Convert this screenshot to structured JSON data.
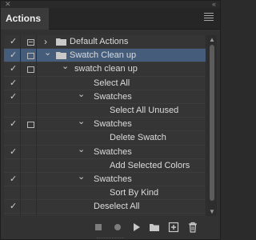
{
  "window": {
    "close_glyph": "✕",
    "collapse_glyph": "‹‹"
  },
  "tab": {
    "label": "Actions"
  },
  "rows": [
    {
      "label": "Default Actions",
      "checked": true,
      "dialog": "toggle-on",
      "expand": "collapsed",
      "indent": 0,
      "folder": true,
      "selected": false
    },
    {
      "label": "Swatch Clean up",
      "checked": true,
      "dialog": "toggle-off",
      "expand": "expanded",
      "indent": 0,
      "folder": true,
      "selected": true
    },
    {
      "label": "swatch clean up",
      "checked": true,
      "dialog": "toggle-off",
      "expand": "expanded",
      "indent": 1,
      "folder": false,
      "selected": false
    },
    {
      "label": "Select All",
      "checked": true,
      "dialog": "",
      "expand": "",
      "indent": 2,
      "folder": false,
      "selected": false
    },
    {
      "label": "Swatches",
      "checked": true,
      "dialog": "",
      "expand": "expanded",
      "indent": 2,
      "folder": false,
      "selected": false
    },
    {
      "label": "Select All Unused",
      "checked": false,
      "dialog": "",
      "expand": "",
      "indent": 3,
      "folder": false,
      "selected": false
    },
    {
      "label": "Swatches",
      "checked": true,
      "dialog": "toggle-off",
      "expand": "expanded",
      "indent": 2,
      "folder": false,
      "selected": false
    },
    {
      "label": "Delete Swatch",
      "checked": false,
      "dialog": "",
      "expand": "",
      "indent": 3,
      "folder": false,
      "selected": false
    },
    {
      "label": "Swatches",
      "checked": true,
      "dialog": "",
      "expand": "expanded",
      "indent": 2,
      "folder": false,
      "selected": false
    },
    {
      "label": "Add Selected Colors",
      "checked": false,
      "dialog": "",
      "expand": "",
      "indent": 3,
      "folder": false,
      "selected": false
    },
    {
      "label": "Swatches",
      "checked": true,
      "dialog": "",
      "expand": "expanded",
      "indent": 2,
      "folder": false,
      "selected": false
    },
    {
      "label": "Sort By Kind",
      "checked": false,
      "dialog": "",
      "expand": "",
      "indent": 3,
      "folder": false,
      "selected": false
    },
    {
      "label": "Deselect All",
      "checked": true,
      "dialog": "",
      "expand": "",
      "indent": 2,
      "folder": false,
      "selected": false
    }
  ],
  "toolbar": {
    "buttons": [
      "stop-icon",
      "record-icon",
      "play-icon",
      "new-set-icon",
      "new-action-icon",
      "delete-icon"
    ]
  },
  "colors": {
    "selected_row": "#455d7a",
    "panel_bg": "#323232"
  }
}
